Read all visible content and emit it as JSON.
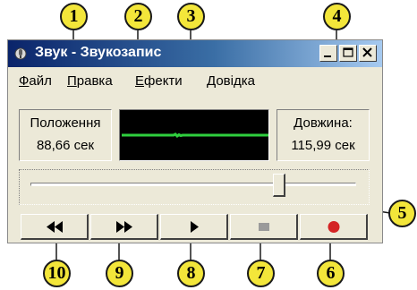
{
  "window": {
    "title": "Звук - Звукозапис",
    "app_icon": "sound-recorder-icon",
    "controls": {
      "minimize": "minimize-icon",
      "maximize": "maximize-icon",
      "close": "close-icon"
    }
  },
  "menu": [
    {
      "underlined": "Ф",
      "rest": "айл"
    },
    {
      "underlined": "П",
      "rest": "равка"
    },
    {
      "underlined": "Е",
      "rest": "фекти"
    },
    {
      "underlined": "Д",
      "rest": "овідка"
    }
  ],
  "position": {
    "label": "Положення",
    "value": "88,66 сек"
  },
  "length": {
    "label": "Довжина:",
    "value": "115,99 сек"
  },
  "slider": {
    "fraction": 0.764
  },
  "buttons": [
    {
      "icon": "rewind-icon"
    },
    {
      "icon": "fast-forward-icon"
    },
    {
      "icon": "play-icon"
    },
    {
      "icon": "stop-icon"
    },
    {
      "icon": "record-icon"
    }
  ],
  "callouts": [
    "1",
    "2",
    "3",
    "4",
    "5",
    "6",
    "7",
    "8",
    "9",
    "10"
  ],
  "colors": {
    "callout_fill": "#f3e63a",
    "wave": "#2fcf3e",
    "record": "#d42424",
    "title_bar": "#0a246a"
  }
}
